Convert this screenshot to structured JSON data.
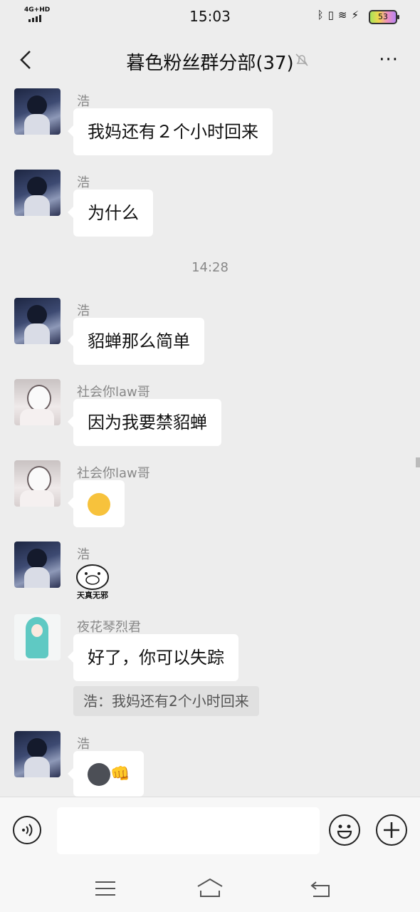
{
  "status_bar": {
    "network": "4G+HD",
    "time": "15:03",
    "battery": "53"
  },
  "header": {
    "title": "暮色粉丝群分部(37)",
    "more": "···"
  },
  "messages": [
    {
      "sender": "浩",
      "text": "我妈还有２个小时回来"
    },
    {
      "sender": "浩",
      "text": "为什么"
    },
    {
      "sender": "浩",
      "text": "貂蝉那么简单"
    },
    {
      "sender": "社会你law哥",
      "text": "因为我要禁貂蝉"
    },
    {
      "sender": "社会你law哥",
      "text": ""
    },
    {
      "sender": "浩",
      "sticker_text": "天真无邪"
    },
    {
      "sender": "夜花琴烈君",
      "text": "好了，你可以失踪",
      "quote": "浩：我妈还有2个小时回来"
    },
    {
      "sender": "浩",
      "text": "👊"
    }
  ],
  "time_separator": "14:28",
  "colors": {
    "background": "#ededed",
    "bubble": "#ffffff",
    "name": "#888888"
  }
}
